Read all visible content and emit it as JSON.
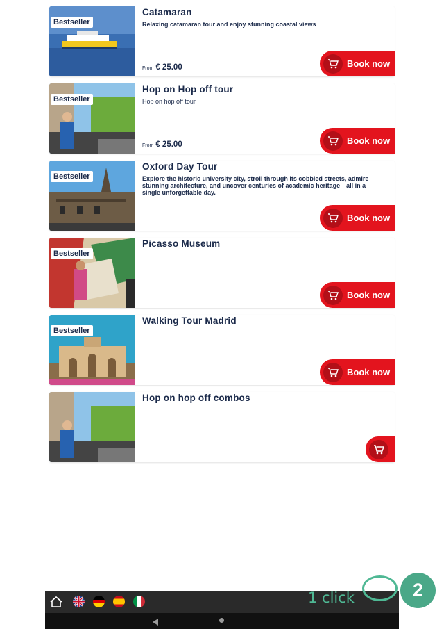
{
  "tours": [
    {
      "title": "Catamaran",
      "badge": "Bestseller",
      "description": "Relaxing catamaran tour and enjoy stunning coastal views",
      "price_from": "From",
      "price": "€ 25.00",
      "book_label": "Book now"
    },
    {
      "title": "Hop on Hop off tour",
      "badge": "Bestseller",
      "description": "Hop on hop off tour",
      "price_from": "From",
      "price": "€ 25.00",
      "book_label": "Book now"
    },
    {
      "title": "Oxford Day Tour",
      "badge": "Bestseller",
      "description": "Explore the historic university city, stroll through its cobbled streets, admire stunning architecture, and uncover centuries of academic heritage—all in a single unforgettable day.",
      "book_label": "Book now"
    },
    {
      "title": "Picasso Museum",
      "badge": "Bestseller",
      "book_label": "Book now"
    },
    {
      "title": "Walking Tour Madrid",
      "badge": "Bestseller",
      "book_label": "Book now"
    },
    {
      "title": "Hop on hop off combos"
    }
  ],
  "annotation": {
    "click_text": "1 click",
    "step_number": "2"
  },
  "taskbar": {
    "icons": [
      "home-icon",
      "uk-flag-icon",
      "german-flag-icon",
      "spanish-flag-icon",
      "italian-flag-icon"
    ]
  },
  "colors": {
    "accent": "#e3141e",
    "text": "#1b2a4a",
    "annotation": "#4fb894"
  }
}
